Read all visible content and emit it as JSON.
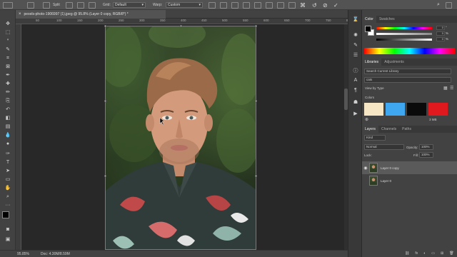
{
  "options_bar": {
    "split_label": "Split",
    "grid_label": "Grid:",
    "grid_value": "Default",
    "warp_label": "Warp:",
    "warp_value": "Custom"
  },
  "document": {
    "tab_title": "pexels-photo-1906997 (1).jpeg @ 95.8% (Layer 0 copy, RGB/8*) *",
    "zoom": "95.85%",
    "doc_size": "Doc: 4.30M/8.59M"
  },
  "rulers": {
    "top_ticks": [
      "50",
      "100",
      "150",
      "200",
      "250",
      "300",
      "350",
      "400",
      "450",
      "500",
      "550",
      "600",
      "650",
      "700",
      "750",
      "800"
    ]
  },
  "tools": [
    "move-tool",
    "artboard-tool",
    "marquee-tool",
    "lasso-tool",
    "quick-select-tool",
    "crop-tool",
    "frame-tool",
    "eyedropper-tool",
    "healing-brush-tool",
    "brush-tool",
    "clone-stamp-tool",
    "history-brush-tool",
    "eraser-tool",
    "gradient-tool",
    "blur-tool",
    "dodge-tool",
    "pen-tool",
    "type-tool",
    "path-select-tool",
    "rectangle-tool",
    "hand-tool",
    "zoom-tool"
  ],
  "color_panel": {
    "tabs": [
      "Color",
      "Swatches"
    ],
    "h_value": "0",
    "s_value": "0",
    "b_value": "0",
    "pct": "%",
    "foreground": "#000000",
    "background": "#ffffff"
  },
  "libraries_panel": {
    "tabs": [
      "Libraries",
      "Adjustments"
    ],
    "search_placeholder": "Search Current Library",
    "library_name": "cats",
    "view_by": "View by Type",
    "colors_label": "Colors",
    "size_label": "3 MB",
    "colors": [
      "#f7e6c4",
      "#3fa7f0",
      "#0a0a0a",
      "#e0191e"
    ]
  },
  "layers_panel": {
    "tabs": [
      "Layers",
      "Channels",
      "Paths"
    ],
    "kind": "Kind",
    "blend_mode": "Normal",
    "opacity_label": "Opacity:",
    "opacity_value": "100%",
    "lock_label": "Lock:",
    "fill_label": "Fill:",
    "fill_value": "100%",
    "layers": [
      {
        "name": "Layer 0 copy",
        "visible": true,
        "selected": true
      },
      {
        "name": "Layer 0",
        "visible": false,
        "selected": false
      }
    ]
  },
  "colors": {
    "ui_dark": "#424242",
    "canvas_bg": "#282828",
    "accent_selected": "#5a5a5a"
  }
}
